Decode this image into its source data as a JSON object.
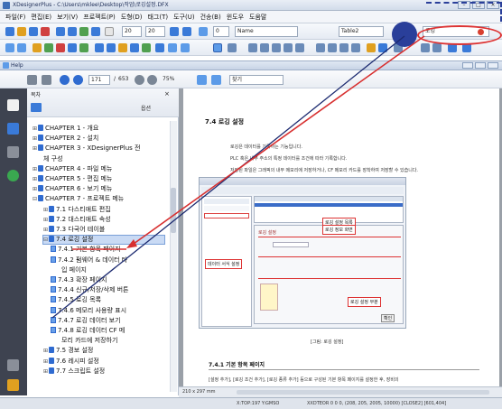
{
  "app": {
    "title": "XDesignerPlus - C:\\Users\\mklee\\Desktop\\작업\\로깅설정.DFX",
    "menus": [
      "파일(F)",
      "편집(E)",
      "보기(V)",
      "프로젝트(P)",
      "도형(D)",
      "태그(T)",
      "도구(U)",
      "건송(B)",
      "윈도우",
      "도움말"
    ],
    "toolbar": {
      "font_size_1": "20",
      "font_size_2": "20",
      "zoom_field": "0",
      "name_field": "Name",
      "table_field": "Table2",
      "logging_field": "로깅"
    }
  },
  "help": {
    "title": "Help",
    "page_current": "171",
    "page_total": "653",
    "zoom": "75%",
    "find_label": "찾기"
  },
  "toc": {
    "header_label": "목차",
    "options_label": "옵션",
    "items": [
      {
        "level": 0,
        "text": "CHAPTER 1 - 개요",
        "expander": "⊞",
        "kind": "book"
      },
      {
        "level": 0,
        "text": "CHAPTER 2 - 설치",
        "expander": "⊞",
        "kind": "book"
      },
      {
        "level": 0,
        "text": "CHAPTER 3 - XDesignerPlus 전",
        "expander": "⊞",
        "kind": "book"
      },
      {
        "level": 1,
        "text": "체 구성",
        "expander": "",
        "kind": "cont"
      },
      {
        "level": 0,
        "text": "CHAPTER 4 - 파일 메뉴",
        "expander": "⊞",
        "kind": "book"
      },
      {
        "level": 0,
        "text": "CHAPTER 5 - 편집 메뉴",
        "expander": "⊞",
        "kind": "book"
      },
      {
        "level": 0,
        "text": "CHAPTER 6 - 보기 메뉴",
        "expander": "⊞",
        "kind": "book"
      },
      {
        "level": 0,
        "text": "CHAPTER 7 - 프로젝트 메뉴",
        "expander": "⊟",
        "kind": "book"
      },
      {
        "level": 1,
        "text": "7.1 다스티애트 편집",
        "expander": "⊞",
        "kind": "book"
      },
      {
        "level": 1,
        "text": "7.2 대스티애트 속성",
        "expander": "⊞",
        "kind": "book"
      },
      {
        "level": 1,
        "text": "7.3 다국어 테이블",
        "expander": "⊞",
        "kind": "book"
      },
      {
        "level": 1,
        "text": "7.4 로깅 설정",
        "expander": "⊟",
        "kind": "book",
        "selected": true
      },
      {
        "level": 2,
        "text": "7.4.1 기본 항목 페이지",
        "expander": "",
        "kind": "page"
      },
      {
        "level": 2,
        "text": "7.4.2 펌웨어 & 데이터 타",
        "expander": "",
        "kind": "page"
      },
      {
        "level": 3,
        "text": "입 페이지",
        "expander": "",
        "kind": "cont"
      },
      {
        "level": 2,
        "text": "7.4.3 확장 페이지",
        "expander": "",
        "kind": "page"
      },
      {
        "level": 2,
        "text": "7.4.4 신규/저장/삭제 버튼",
        "expander": "",
        "kind": "page"
      },
      {
        "level": 2,
        "text": "7.4.5 로깅 목록",
        "expander": "",
        "kind": "page"
      },
      {
        "level": 2,
        "text": "7.4.6 메모리 사용량 표시",
        "expander": "",
        "kind": "page"
      },
      {
        "level": 2,
        "text": "7.4.7 로깅 데이터 보기",
        "expander": "",
        "kind": "page"
      },
      {
        "level": 2,
        "text": "7.4.8 로깅 데이터 CF 메",
        "expander": "",
        "kind": "page"
      },
      {
        "level": 3,
        "text": "모리 카드에 저장하기",
        "expander": "",
        "kind": "cont"
      },
      {
        "level": 1,
        "text": "7.5 경보 설정",
        "expander": "⊞",
        "kind": "book"
      },
      {
        "level": 1,
        "text": "7.6 레시피 설정",
        "expander": "⊞",
        "kind": "book"
      },
      {
        "level": 1,
        "text": "7.7 스크립트 설정",
        "expander": "⊞",
        "kind": "book"
      }
    ]
  },
  "doc": {
    "section_title": "7.4  로깅 설정",
    "para_1": "로깅은 데이터를 기록하는 기능입니다.",
    "para_2": "PLC 혹은 내부 주소의 특정 데이터를 조건에 따라 기록합니다.",
    "para_3": "저장된 파일은 그래픽의 내부 메모리에 저장하거나, CF 메모리 카드를 장착하여 저장할 수 있습니다.",
    "figure_caption": "[그림: 로깅 설정]",
    "subsection_title": "7.4.1   기본 항목 페이지",
    "para_4": "[설정 추가], [로깅 조건 추가], [로깅 종류 추가] 등으로 구성된 기본 항목 페이지를 설정한 후, 장비의"
  },
  "figure": {
    "callout_1": "로깅 설정 목록",
    "callout_2": "로깅 정보 화면",
    "callout_3": "데이터 서식 설정",
    "callout_4": "로깅 설정 부분",
    "panel_label": "로깅 설정",
    "ok_label": "확인"
  },
  "status": {
    "page_size": "210 x 297 mm",
    "bottom_left": "X:TOP:197 Y:GMSO",
    "bottom_right": "XXDTEOR 0 0 0, (208, 205, 2005, 10000) [CLOSE2]   [601,404]"
  }
}
